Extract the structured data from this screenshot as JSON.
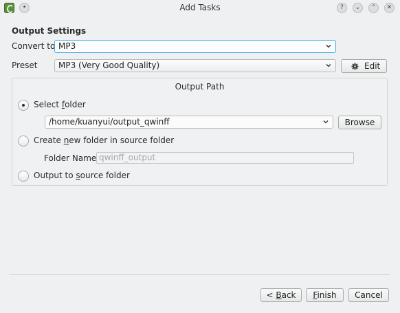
{
  "window": {
    "title": "Add Tasks"
  },
  "titlebar_buttons": {
    "pin": "•",
    "help": "?",
    "minimize": "⌄",
    "maximize": "⌃",
    "close": "✕"
  },
  "output_settings": {
    "heading": "Output Settings",
    "convert_to_label": "Convert to",
    "convert_to_value": "MP3",
    "preset_label": "Preset",
    "preset_value": "MP3 (Very Good Quality)",
    "edit_button": "Edit"
  },
  "output_path": {
    "heading": "Output Path",
    "select_folder": {
      "label_pre": "Select ",
      "label_accel": "f",
      "label_post": "older",
      "checked": true
    },
    "folder_path": "/home/kuanyui/output_qwinff",
    "browse_button": "Browse",
    "create_new": {
      "label_pre": "Create ",
      "label_accel": "n",
      "label_post": "ew folder in source folder",
      "checked": false
    },
    "folder_name_label": "Folder Name",
    "folder_name_value": "qwinff_output",
    "output_to_source": {
      "label_pre": "Output to ",
      "label_accel": "s",
      "label_post": "ource folder",
      "checked": false
    }
  },
  "footer": {
    "back_pre": "< ",
    "back_accel": "B",
    "back_post": "ack",
    "finish_accel": "F",
    "finish_post": "inish",
    "cancel": "Cancel"
  },
  "colors": {
    "focus_border": "#3daee9",
    "window_bg": "#eff0f1"
  },
  "icons": {
    "app": "qwinff-app-icon",
    "gear": "gear-icon",
    "chevron": "chevron-down-icon"
  }
}
